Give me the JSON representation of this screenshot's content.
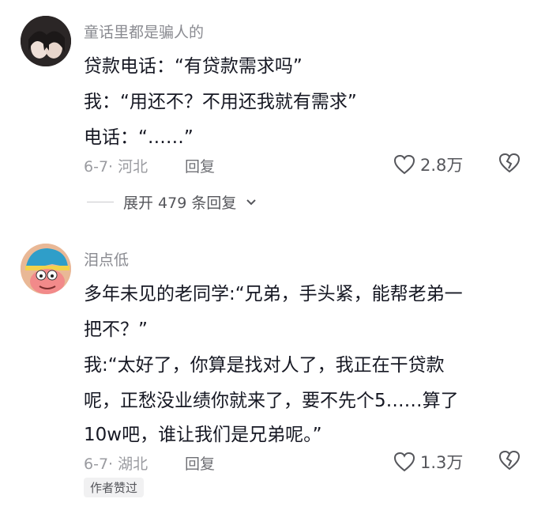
{
  "comments": [
    {
      "username": "童话里都是骗人的",
      "lines": [
        "贷款电话：“有贷款需求吗”",
        "我：“用还不？不用还我就有需求”",
        "电话：“……”"
      ],
      "date_location": "6-7· 河北",
      "reply_label": "回复",
      "likes": "2.8万",
      "expand_replies": "展开 479 条回复"
    },
    {
      "username": "泪点低",
      "lines": [
        "多年未见的老同学:“兄弟，手头紧，能帮老弟一",
        "把不？”",
        "我:“太好了，你算是找对人了，我正在干贷款",
        "呢，正愁没业绩你就来了，要不先个5……算了",
        "10w吧，谁让我们是兄弟呢。”"
      ],
      "date_location": "6-7· 湖北",
      "reply_label": "回复",
      "likes": "1.3万",
      "badge": "作者赞过"
    }
  ]
}
